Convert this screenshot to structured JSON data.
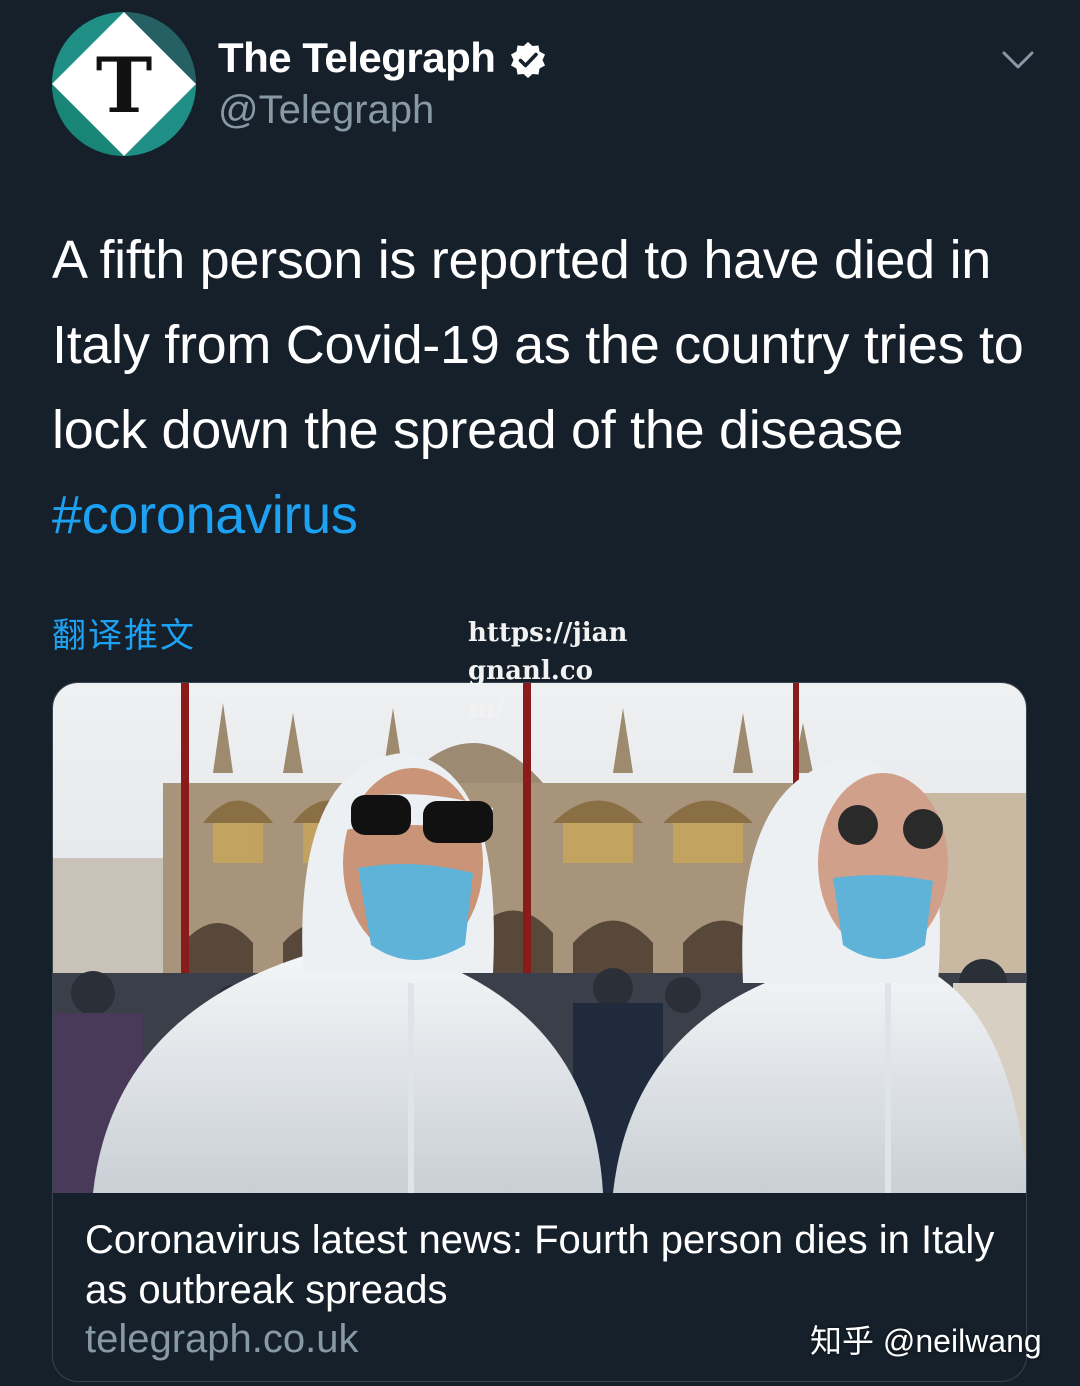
{
  "header": {
    "avatar_letter": "T",
    "display_name": "The Telegraph",
    "handle": "@Telegraph",
    "verified_icon": "verified-badge-icon",
    "menu_icon": "chevron-down-icon"
  },
  "tweet": {
    "text": "A fifth person is reported to have died in Italy from Covid-19 as the country tries to lock down the spread of the disease ",
    "hashtag": "#coronavirus",
    "translate_label": "翻译推文"
  },
  "watermark_url": "https://jiangnanl.com/",
  "card": {
    "title": "Coronavirus latest news: Fourth person dies in Italy as outbreak spreads",
    "domain": "telegraph.co.uk"
  },
  "zhihu_watermark": "知乎 @neilwang",
  "colors": {
    "background": "#15202b",
    "accent": "#1da1f2",
    "secondary_text": "#8899a6",
    "avatar_teal": "#1f8f86"
  }
}
